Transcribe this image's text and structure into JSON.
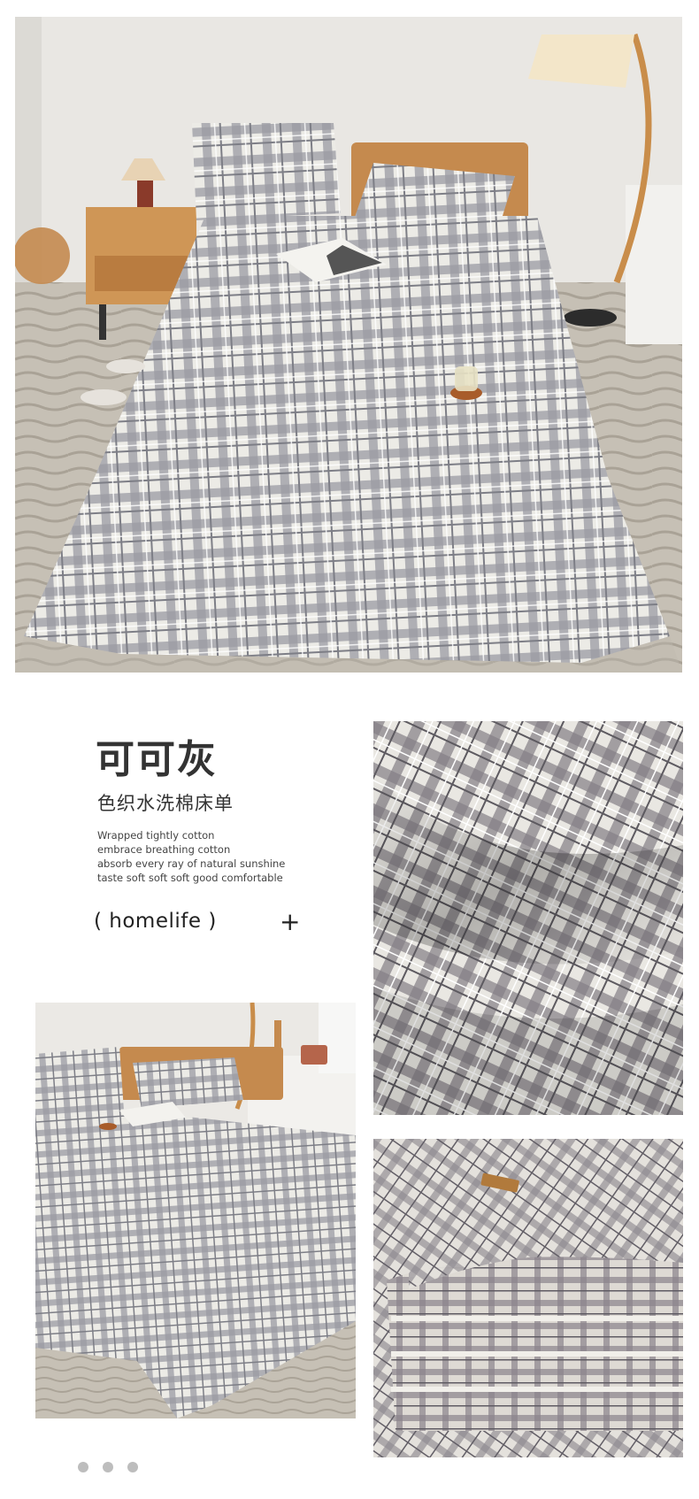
{
  "product": {
    "name": "可可灰",
    "subtitle": "色织水洗棉床单",
    "description": [
      "Wrapped tightly cotton",
      "embrace breathing cotton",
      "absorb every ray of natural sunshine",
      "taste soft soft soft good comfortable"
    ],
    "brand": "( homelife )",
    "plus_symbol": "+"
  },
  "gallery": {
    "dot_count": 3
  },
  "colors": {
    "plaid_gray": "#8e8f96",
    "plaid_light": "#ecebe6",
    "wood": "#c58a4e",
    "carpet": "#bfb9ae",
    "text": "#333333"
  }
}
